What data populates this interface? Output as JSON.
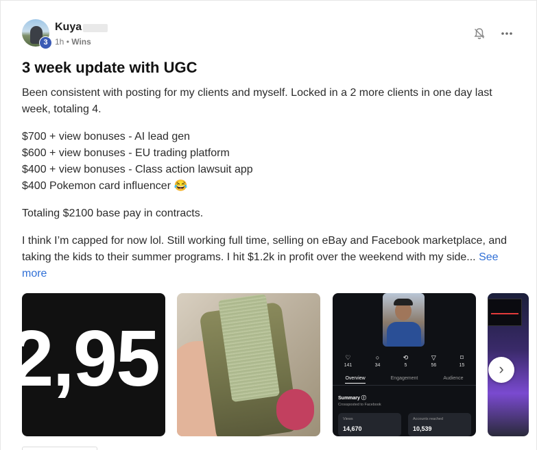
{
  "post": {
    "author": "Kuya",
    "level": "3",
    "time": "1h",
    "separator": "•",
    "category": "Wins",
    "title": "3 week update with UGC",
    "paragraphs": [
      "Been consistent with posting for my clients and myself. Locked in a 2 more clients in one day last week, totaling 4.",
      "$700 + view bonuses - AI lead gen",
      "$600 + view bonuses - EU trading platform",
      "$400 + view bonuses - Class action lawsuit app",
      "$400 Pokemon card influencer 😂",
      "Totaling $2100 base pay in contracts.",
      "I think I’m capped for now lol. Still working full time, selling on eBay and Facebook marketplace, and taking the kids to their summer programs. I hit $1.2k in profit over the weekend with my side..."
    ],
    "see_more": "See more"
  },
  "icons": {
    "bell": "bell-off-icon",
    "more": "more-horizontal-icon",
    "next": "chevron-right-icon"
  },
  "gallery": {
    "image1_text": "2,95",
    "insights": {
      "stats": [
        {
          "icon": "heart-icon",
          "value": "141"
        },
        {
          "icon": "comment-icon",
          "value": "34"
        },
        {
          "icon": "repost-icon",
          "value": "5"
        },
        {
          "icon": "share-icon",
          "value": "56"
        },
        {
          "icon": "bookmark-icon",
          "value": "15"
        }
      ],
      "tabs": [
        "Overview",
        "Engagement",
        "Audience"
      ],
      "summary_title": "Summary",
      "summary_sub": "Crossposted to Facebook",
      "views_label": "Views",
      "views_value": "14,670",
      "accounts_label": "Accounts reached",
      "accounts_value": "10,539"
    }
  },
  "colors": {
    "link": "#2f6fd6",
    "level_badge": "#3b5bb5"
  }
}
